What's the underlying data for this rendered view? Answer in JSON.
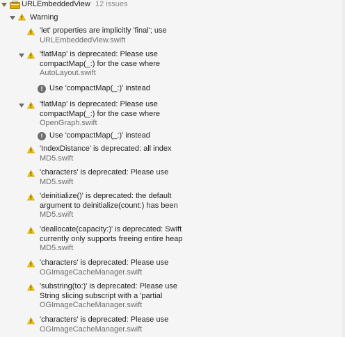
{
  "project": {
    "name": "URLEmbeddedView",
    "count": "12 issues"
  },
  "group": {
    "label": "Warning"
  },
  "issues": [
    {
      "lines": [
        "'let' properties are implicitly 'final'; use"
      ],
      "file": "URLEmbeddedView.swift"
    },
    {
      "lines": [
        "'flatMap' is deprecated: Please use",
        "compactMap(_:) for the case where"
      ],
      "file": "AutoLayout.swift",
      "note": "Use 'compactMap(_:)' instead"
    },
    {
      "lines": [
        "'flatMap' is deprecated: Please use",
        "compactMap(_:) for the case where"
      ],
      "file": "OpenGraph.swift",
      "note": "Use 'compactMap(_:)' instead"
    },
    {
      "lines": [
        "'IndexDistance' is deprecated: all index"
      ],
      "file": "MD5.swift"
    },
    {
      "lines": [
        "'characters' is deprecated: Please use"
      ],
      "file": "MD5.swift"
    },
    {
      "lines": [
        "'deinitialize()' is deprecated: the default",
        "argument to deinitialize(count:) has been"
      ],
      "file": "MD5.swift"
    },
    {
      "lines": [
        "'deallocate(capacity:)' is deprecated: Swift",
        "currently only supports freeing entire heap"
      ],
      "file": "MD5.swift"
    },
    {
      "lines": [
        "'characters' is deprecated: Please use"
      ],
      "file": "OGImageCacheManager.swift"
    },
    {
      "lines": [
        "'substring(to:)' is deprecated: Please use",
        "String slicing subscript with a 'partial"
      ],
      "file": "OGImageCacheManager.swift"
    },
    {
      "lines": [
        "'characters' is deprecated: Please use"
      ],
      "file": "OGImageCacheManager.swift"
    }
  ],
  "colors": {
    "warning": "#f5c400",
    "info": "#6e6e6e",
    "background": "#f5f5f5"
  }
}
